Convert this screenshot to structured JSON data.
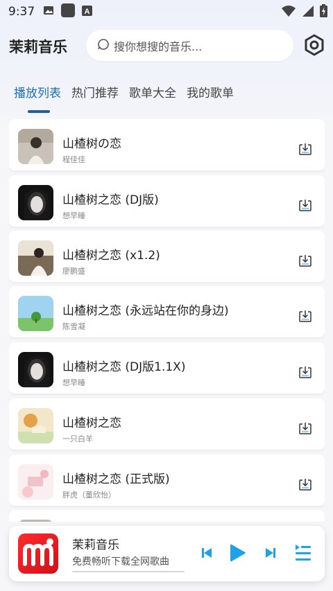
{
  "status_bar": {
    "time": "9:37"
  },
  "header": {
    "app_title": "茉莉音乐",
    "search_placeholder": "搜你想搜的音乐..."
  },
  "tabs": [
    {
      "label": "播放列表",
      "active": true
    },
    {
      "label": "热门推荐",
      "active": false
    },
    {
      "label": "歌单大全",
      "active": false
    },
    {
      "label": "我的歌单",
      "active": false
    }
  ],
  "songs": [
    {
      "title": "山楂树の恋",
      "artist": "程佳佳"
    },
    {
      "title": "山楂树之恋 (DJ版)",
      "artist": "想早睡"
    },
    {
      "title": "山楂树之恋 (x1.2)",
      "artist": "廖鹏盛"
    },
    {
      "title": "山楂树之恋 (永远站在你的身边)",
      "artist": "陈雪凝"
    },
    {
      "title": "山楂树之恋 (DJ版1.1X)",
      "artist": "想早睡"
    },
    {
      "title": "山楂树之恋",
      "artist": "一只白羊"
    },
    {
      "title": "山楂树之恋 (正式版)",
      "artist": "胖虎（董欣怡）"
    }
  ],
  "player": {
    "title": "茉莉音乐",
    "subtitle": "免费畅听下载全网歌曲",
    "progress": 0.0
  },
  "colors": {
    "accent": "#1b6fb5",
    "control_blue": "#1aa3e8",
    "logo_red": "#e8141f"
  },
  "icons": [
    "image-icon",
    "square-icon",
    "a-box-icon",
    "wifi-icon",
    "battery-icon",
    "search-icon",
    "settings-hex-icon",
    "download-icon",
    "previous-icon",
    "play-icon",
    "next-icon",
    "playlist-icon"
  ]
}
